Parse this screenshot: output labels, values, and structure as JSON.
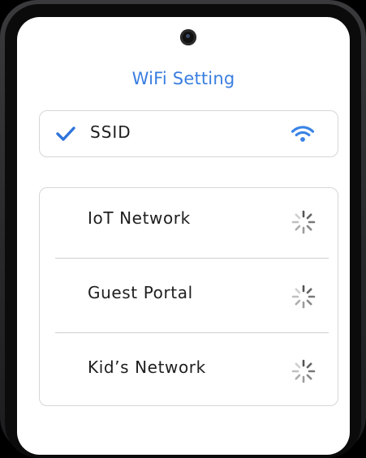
{
  "header": {
    "title": "WiFi Setting"
  },
  "connected": {
    "ssid_label": "SSID",
    "status_icon": "check-icon",
    "signal_icon": "wifi-icon",
    "accent_color": "#3a7ee0"
  },
  "networks": [
    {
      "label": "IoT Network",
      "status_icon": "loading-spinner-icon"
    },
    {
      "label": "Guest Portal",
      "status_icon": "loading-spinner-icon"
    },
    {
      "label": "Kid’s Network",
      "status_icon": "loading-spinner-icon"
    }
  ]
}
